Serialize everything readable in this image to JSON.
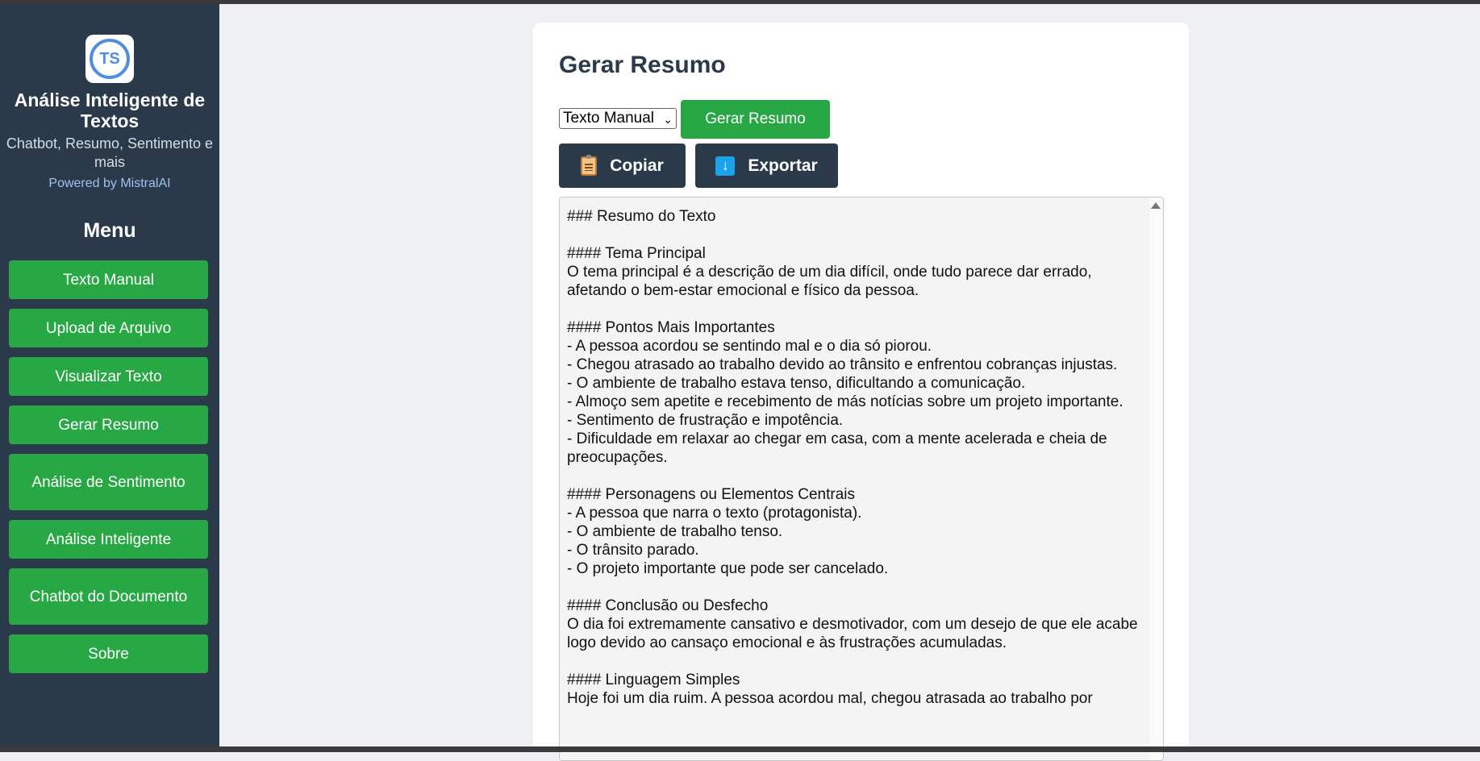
{
  "sidebar": {
    "logo_text": "TS",
    "title": "Análise Inteligente de Textos",
    "subtitle": "Chatbot, Resumo, Sentimento e mais",
    "powered_by": "Powered by MistralAI",
    "menu_title": "Menu",
    "items": [
      {
        "label": "Texto Manual"
      },
      {
        "label": "Upload de Arquivo"
      },
      {
        "label": "Visualizar Texto"
      },
      {
        "label": "Gerar Resumo"
      },
      {
        "label": "Análise de Sentimento"
      },
      {
        "label": "Análise Inteligente"
      },
      {
        "label": "Chatbot do Documento"
      },
      {
        "label": "Sobre"
      }
    ]
  },
  "main": {
    "title": "Gerar Resumo",
    "source_select": {
      "value": "Texto Manual"
    },
    "generate_label": "Gerar Resumo",
    "copy_label": "Copiar",
    "export_label": "Exportar",
    "summary": "### Resumo do Texto\n\n#### Tema Principal\nO tema principal é a descrição de um dia difícil, onde tudo parece dar errado, afetando o bem-estar emocional e físico da pessoa.\n\n#### Pontos Mais Importantes\n- A pessoa acordou se sentindo mal e o dia só piorou.\n- Chegou atrasado ao trabalho devido ao trânsito e enfrentou cobranças injustas.\n- O ambiente de trabalho estava tenso, dificultando a comunicação.\n- Almoço sem apetite e recebimento de más notícias sobre um projeto importante.\n- Sentimento de frustração e impotência.\n- Dificuldade em relaxar ao chegar em casa, com a mente acelerada e cheia de preocupações.\n\n#### Personagens ou Elementos Centrais\n- A pessoa que narra o texto (protagonista).\n- O ambiente de trabalho tenso.\n- O trânsito parado.\n- O projeto importante que pode ser cancelado.\n\n#### Conclusão ou Desfecho\nO dia foi extremamente cansativo e desmotivador, com um desejo de que ele acabe logo devido ao cansaço emocional e às frustrações acumuladas.\n\n#### Linguagem Simples\nHoje foi um dia ruim. A pessoa acordou mal, chegou atrasada ao trabalho por"
  },
  "colors": {
    "sidebar_bg": "#2b3a4b",
    "accent_green": "#28a745",
    "page_bg": "#eef0f3"
  }
}
